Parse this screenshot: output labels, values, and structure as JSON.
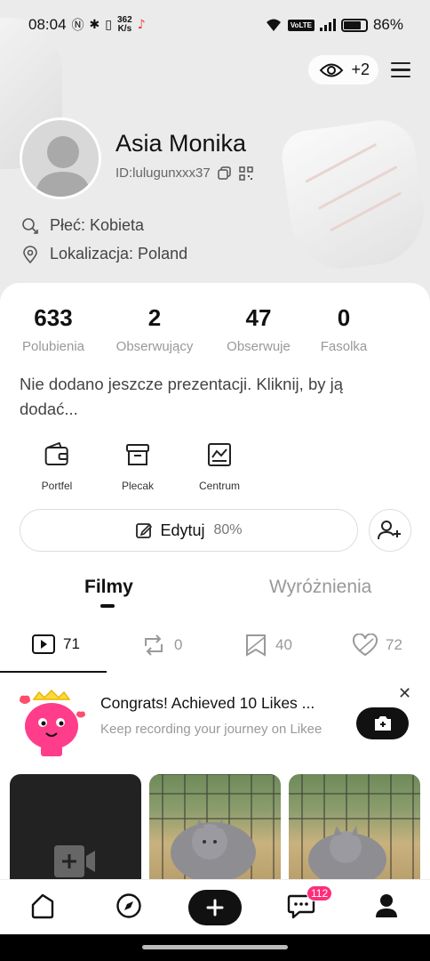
{
  "status_bar": {
    "time": "08:04",
    "net_speed_value": "362",
    "net_speed_unit": "K/s",
    "volte": "VoLTE",
    "battery": "86%"
  },
  "header": {
    "viewers_count": "+2"
  },
  "profile": {
    "name": "Asia Monika",
    "user_id": "ID:lulugunxxx37",
    "gender": "Płeć: Kobieta",
    "location": "Lokalizacja: Poland"
  },
  "stats": [
    {
      "value": "633",
      "label": "Polubienia"
    },
    {
      "value": "2",
      "label": "Obserwujący"
    },
    {
      "value": "47",
      "label": "Obserwuje"
    },
    {
      "value": "0",
      "label": "Fasolka"
    }
  ],
  "bio": "Nie dodano jeszcze prezentacji. Kliknij, by ją dodać...",
  "quick_actions": [
    {
      "label": "Portfel",
      "icon": "wallet-icon"
    },
    {
      "label": "Plecak",
      "icon": "backpack-icon"
    },
    {
      "label": "Centrum",
      "icon": "chart-icon"
    }
  ],
  "edit": {
    "label": "Edytuj",
    "completion": "80%"
  },
  "tabs": [
    {
      "label": "Filmy",
      "active": true
    },
    {
      "label": "Wyróżnienia",
      "active": false
    }
  ],
  "subtabs": [
    {
      "icon": "video-icon",
      "count": "71"
    },
    {
      "icon": "repost-icon",
      "count": "0"
    },
    {
      "icon": "bookmark-icon",
      "count": "40"
    },
    {
      "icon": "heart-icon",
      "count": "72"
    }
  ],
  "congrats": {
    "title": "Congrats! Achieved 10 Likes ...",
    "subtitle": "Keep recording your journey on Likee"
  },
  "bottom_nav": {
    "messages_badge": "112"
  },
  "colors": {
    "accent": "#ff2e7a",
    "dark": "#111111"
  }
}
